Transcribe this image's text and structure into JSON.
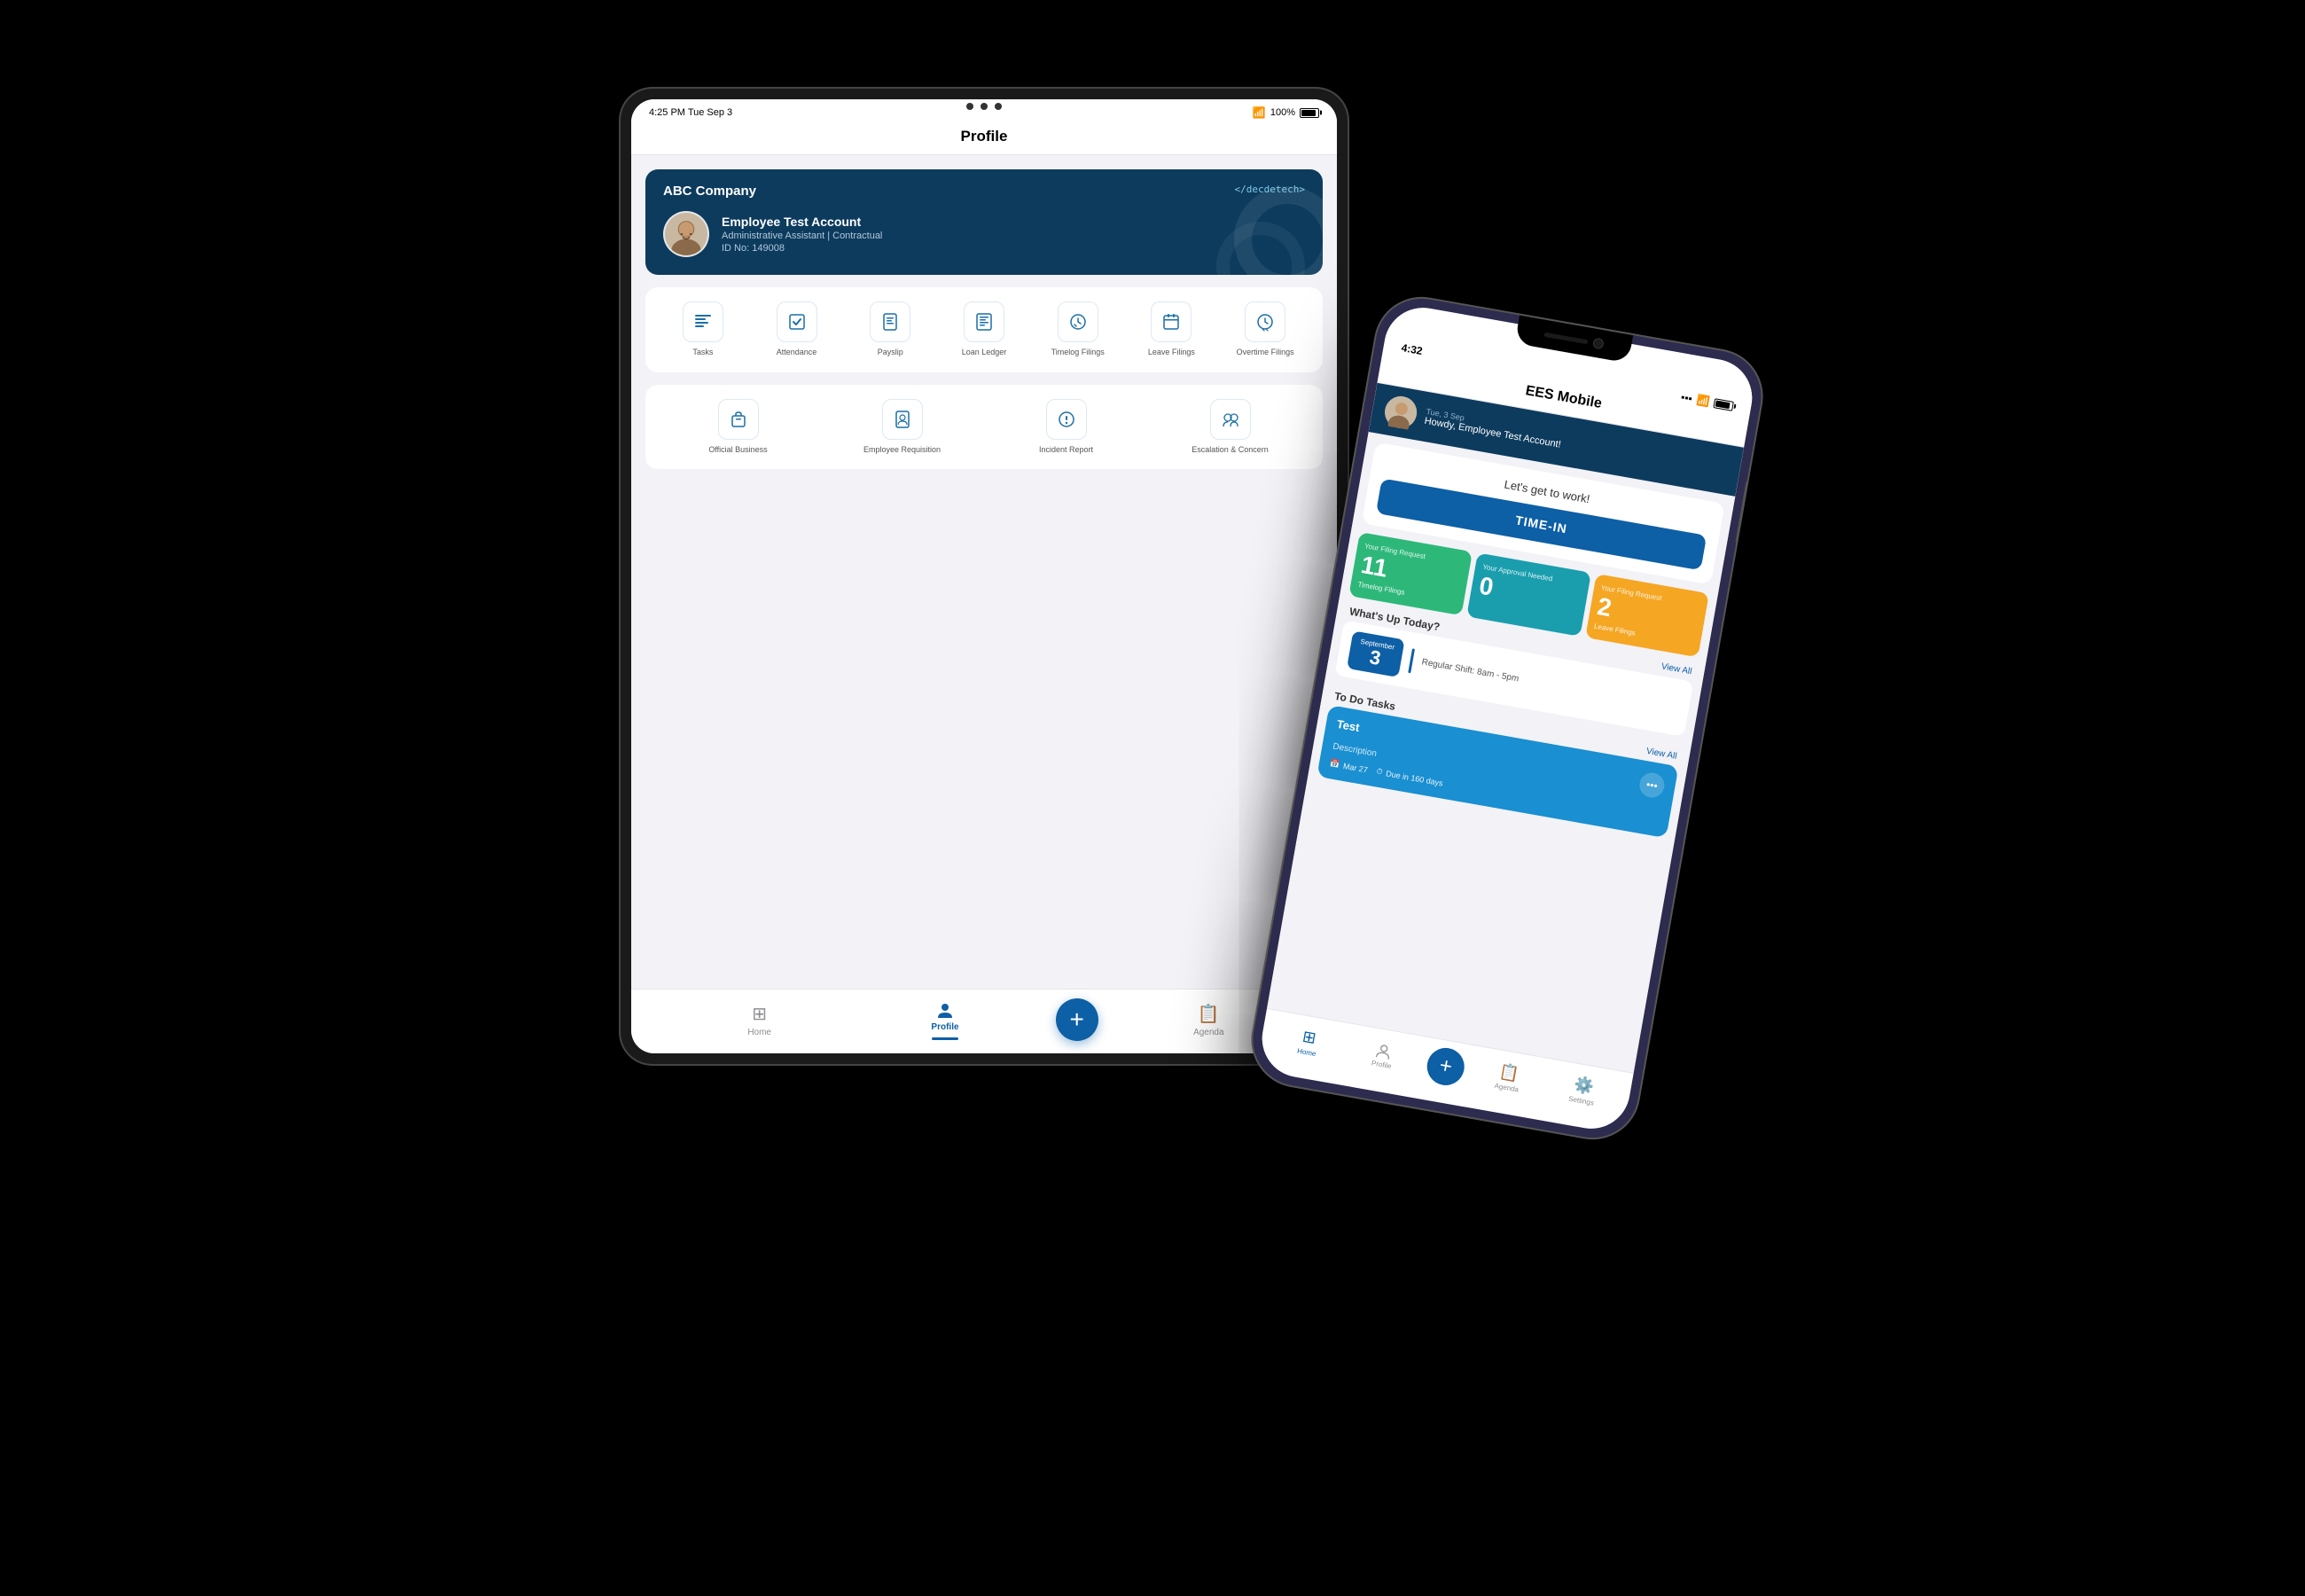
{
  "tablet": {
    "status_time": "4:25 PM  Tue Sep 3",
    "status_wifi": "WiFi",
    "status_battery": "100%",
    "title": "Profile",
    "profile_card": {
      "company": "ABC Company",
      "brand": "</dec​​detech>",
      "user_name": "Employee Test Account",
      "user_role": "Administrative Assistant | Contractual",
      "user_id": "ID No: 149008"
    },
    "menu_row1": [
      {
        "id": "tasks",
        "label": "Tasks",
        "icon": "list"
      },
      {
        "id": "attendance",
        "label": "Attendance",
        "icon": "check"
      },
      {
        "id": "payslip",
        "label": "Payslip",
        "icon": "doc"
      },
      {
        "id": "loan",
        "label": "Loan Ledger",
        "icon": "book"
      },
      {
        "id": "timelog",
        "label": "Timelog Filings",
        "icon": "clock-check"
      },
      {
        "id": "leave",
        "label": "Leave Filings",
        "icon": "calendar"
      },
      {
        "id": "overtime",
        "label": "Overtime Filings",
        "icon": "clock-alarm"
      }
    ],
    "menu_row2": [
      {
        "id": "official",
        "label": "Official Business",
        "icon": "briefcase"
      },
      {
        "id": "requisition",
        "label": "Employee Requisition",
        "icon": "doc-person"
      },
      {
        "id": "incident",
        "label": "Incident Report",
        "icon": "exclamation"
      },
      {
        "id": "escalation",
        "label": "Escalation & Concern",
        "icon": "people"
      }
    ],
    "bottom_nav": [
      {
        "id": "home",
        "label": "Home",
        "active": false
      },
      {
        "id": "profile",
        "label": "Profile",
        "active": true
      },
      {
        "id": "add",
        "label": "+",
        "is_add": true
      },
      {
        "id": "agenda",
        "label": "Agenda",
        "active": false
      }
    ]
  },
  "phone": {
    "status_time": "4:32",
    "app_title": "EES Mobile",
    "header": {
      "date": "Tue, 3 Sep",
      "greeting": "Howdy, Employee Test Account!"
    },
    "lets_work": "Let's get to work!",
    "time_in_label": "TIME-IN",
    "stats": [
      {
        "color": "green",
        "top_label": "Your Filing Request",
        "number": "11",
        "bottom_label": "Timelog Filings"
      },
      {
        "color": "teal",
        "top_label": "Your Approval Needed",
        "number": "0",
        "bottom_label": ""
      },
      {
        "color": "yellow",
        "top_label": "Your Filing Request",
        "number": "2",
        "bottom_label": "Leave Filings"
      }
    ],
    "whats_up": {
      "title": "What's Up Today?",
      "view_all": "View All",
      "schedule": {
        "month": "September",
        "day": "3",
        "shift": "Regular Shift: 8am - 5pm"
      }
    },
    "todo": {
      "title": "To Do Tasks",
      "view_all": "View All",
      "task": {
        "title": "Test",
        "description": "Description",
        "date_tag": "Mar 27",
        "due_tag": "Due in 160 days"
      }
    },
    "bottom_nav": [
      {
        "id": "home",
        "label": "Home",
        "active": true
      },
      {
        "id": "profile",
        "label": "Profile",
        "active": false
      },
      {
        "id": "add",
        "label": "+",
        "is_add": true
      },
      {
        "id": "agenda",
        "label": "Agenda",
        "active": false
      },
      {
        "id": "settings",
        "label": "Settings",
        "active": false
      }
    ]
  }
}
